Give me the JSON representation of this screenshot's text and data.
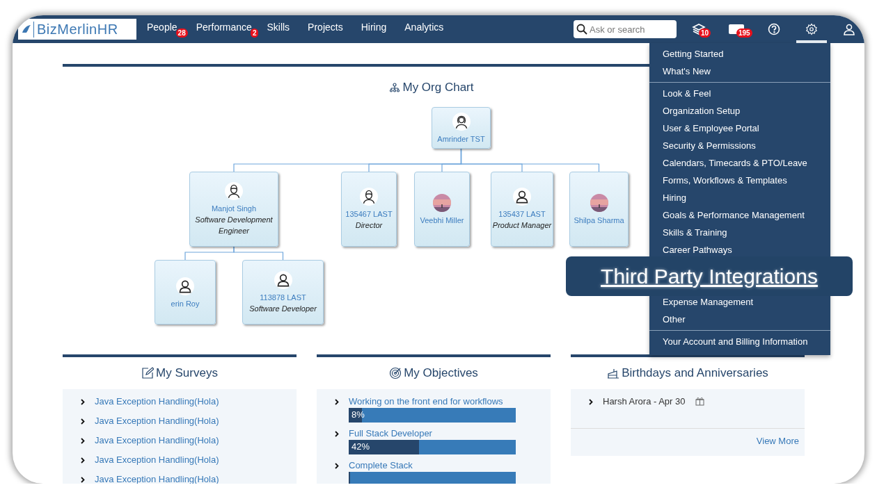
{
  "nav": {
    "logo": "BizMerlinHR",
    "items": [
      {
        "label": "People",
        "badge": "28"
      },
      {
        "label": "Performance",
        "badge": "2"
      },
      {
        "label": "Skills"
      },
      {
        "label": "Projects"
      },
      {
        "label": "Hiring"
      },
      {
        "label": "Analytics"
      }
    ],
    "search": {
      "placeholder": "Ask or search"
    },
    "icons": [
      {
        "kind": "stack",
        "badge": "10",
        "selected": false
      },
      {
        "kind": "card",
        "badge": "195",
        "selected": false
      },
      {
        "kind": "help",
        "selected": false
      },
      {
        "kind": "settings",
        "selected": true
      },
      {
        "kind": "user",
        "selected": false
      }
    ]
  },
  "settings_menu": {
    "groups": [
      {
        "items": [
          "Getting Started",
          "What's New"
        ]
      },
      {
        "items": [
          "Look & Feel",
          "Organization Setup",
          "User & Employee Portal",
          "Security & Permissions",
          "Calendars, Timecards & PTO/Leave",
          "Forms, Workflows & Templates",
          "Hiring",
          "Goals & Performance Management",
          "Skills & Training",
          "Career Pathways"
        ],
        "after": [
          "Expense Management",
          "Other"
        ]
      },
      {
        "items": [
          "Your Account and Billing Information"
        ]
      }
    ]
  },
  "callout": {
    "text": "Third Party Integrations"
  },
  "org_chart": {
    "title": "My Org Chart",
    "root": {
      "name": "Amrinder TST",
      "kind": "female",
      "children": [
        {
          "name": "Manjot Singh",
          "role": "Software Development Engineer",
          "kind": "male",
          "children": [
            {
              "name": "erin Roy",
              "kind": "user"
            },
            {
              "name": "113878 LAST",
              "role": "Software Developer",
              "kind": "user"
            }
          ]
        },
        {
          "name": "135467 LAST",
          "role": "Director",
          "kind": "male"
        },
        {
          "name": "Veebhi Miller"
        },
        {
          "name": "135437 LAST",
          "role": "Product Manager",
          "kind": "user"
        },
        {
          "name": "Shilpa Sharma"
        }
      ]
    }
  },
  "surveys": {
    "title": "My Surveys",
    "items": [
      "Java Exception Handling(Hola)",
      "Java Exception Handling(Hola)",
      "Java Exception Handling(Hola)",
      "Java Exception Handling(Hola)",
      "Java Exception Handling(Hola)"
    ]
  },
  "objectives": {
    "title": "My Objectives",
    "items": [
      {
        "name": "Working on the front end for workflows",
        "level": 0.08,
        "reading": "8%"
      },
      {
        "name": "Full Stack Developer",
        "level": 0.42,
        "reading": "42%"
      },
      {
        "name": "Complete Stack",
        "level": 0.01
      }
    ]
  },
  "birthdays": {
    "title": "Birthdays and Anniversaries",
    "items": [
      {
        "text": "Harsh Arora - Apr 30"
      }
    ],
    "view_more": "View More"
  }
}
